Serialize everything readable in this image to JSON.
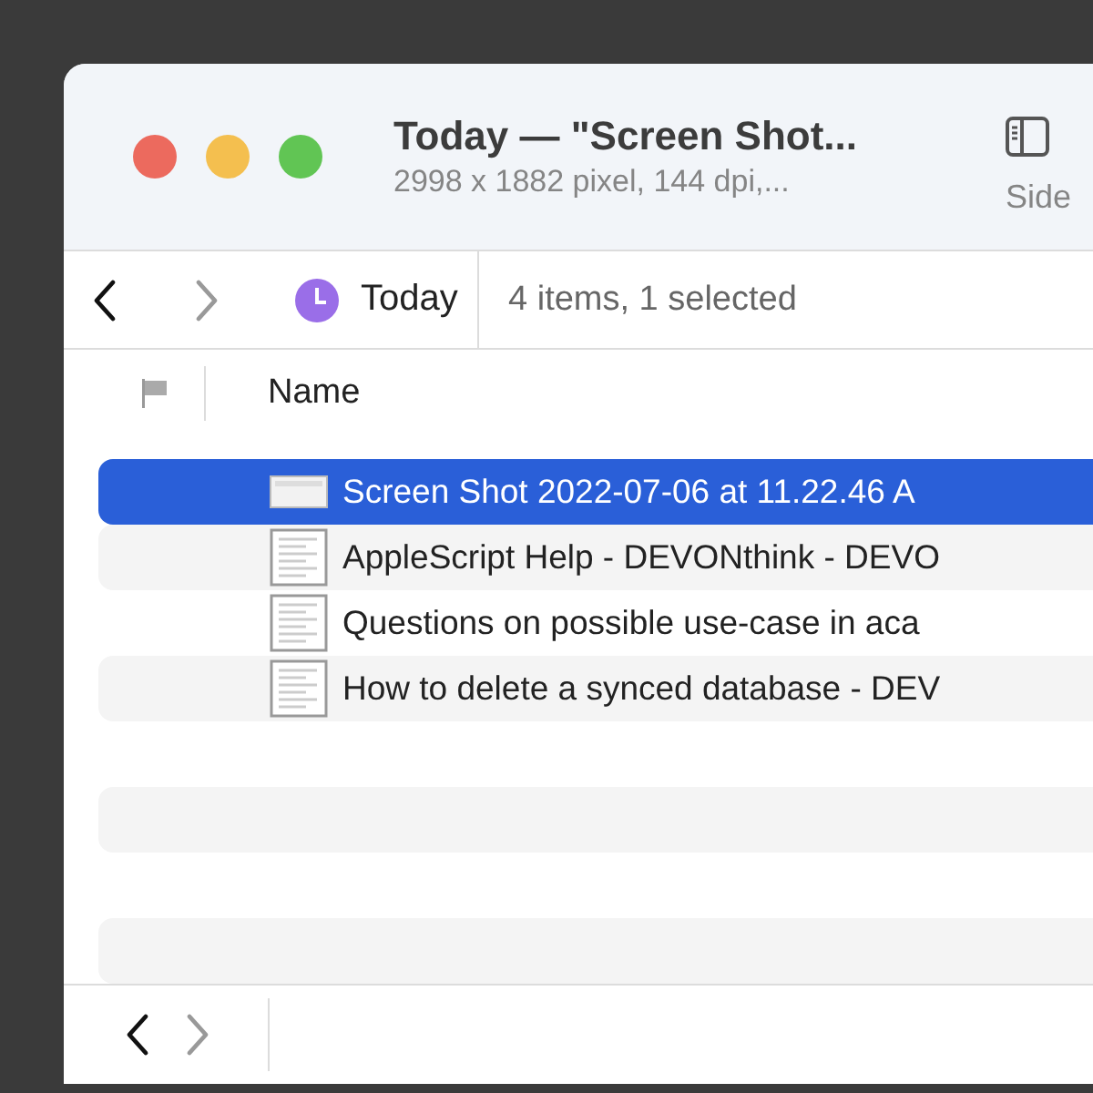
{
  "window": {
    "title": "Today — \"Screen Shot...",
    "subtitle": "2998 x 1882 pixel, 144 dpi,...",
    "sidebar_button": {
      "label": "Side"
    }
  },
  "toolbar": {
    "back": {
      "disabled": false
    },
    "forward": {
      "disabled": true
    },
    "location": "Today",
    "status": "4 items, 1 selected"
  },
  "table": {
    "columns": [
      {
        "kind": "flag"
      },
      {
        "kind": "text",
        "label": "Name"
      }
    ],
    "rows": [
      {
        "name": "Screen Shot 2022-07-06 at 11.22.46 A",
        "kind": "image",
        "selected": true
      },
      {
        "name": "AppleScript Help - DEVONthink - DEVO",
        "kind": "document",
        "selected": false
      },
      {
        "name": "Questions on possible use-case in aca",
        "kind": "document",
        "selected": false
      },
      {
        "name": "How to delete a synced database - DEV",
        "kind": "document",
        "selected": false
      }
    ]
  },
  "bottom_bar": {
    "back": {
      "disabled": false
    },
    "forward": {
      "disabled": true
    }
  }
}
